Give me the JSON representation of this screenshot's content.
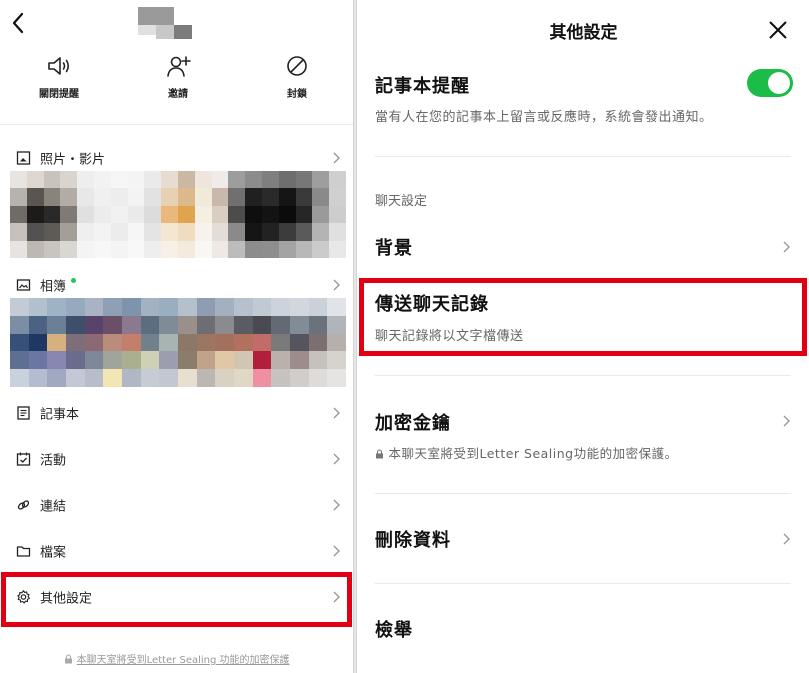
{
  "left_panel": {
    "actions": [
      {
        "label": "關閉提醒",
        "icon": "speaker-icon"
      },
      {
        "label": "邀請",
        "icon": "add-user-icon"
      },
      {
        "label": "封鎖",
        "icon": "block-icon"
      }
    ],
    "photos_label": "照片・影片",
    "album_label": "相簿",
    "list_items": [
      {
        "label": "記事本",
        "icon": "note-icon"
      },
      {
        "label": "活動",
        "icon": "calendar-check-icon"
      },
      {
        "label": "連結",
        "icon": "link-icon"
      },
      {
        "label": "檔案",
        "icon": "folder-icon"
      },
      {
        "label": "其他設定",
        "icon": "gear-icon"
      }
    ],
    "footer_text": "本聊天室將受到Letter Sealing 功能的加密保護"
  },
  "right_panel": {
    "title": "其他設定",
    "note_reminder": {
      "title": "記事本提醒",
      "description": "當有人在您的記事本上留言或反應時，系統會發出通知。",
      "enabled": true
    },
    "chat_settings_header": "聊天設定",
    "background_label": "背景",
    "send_chat_history": {
      "title": "傳送聊天記錄",
      "description": "聊天記錄將以文字檔傳送"
    },
    "encryption_key": {
      "title": "加密金鑰",
      "description": "本聊天室將受到Letter Sealing功能的加密保護。"
    },
    "delete_data_label": "刪除資料",
    "report_label": "檢舉"
  },
  "colors": {
    "highlight": "#e00012",
    "toggle_on": "#1bbd48",
    "online_dot": "#22c55e"
  }
}
